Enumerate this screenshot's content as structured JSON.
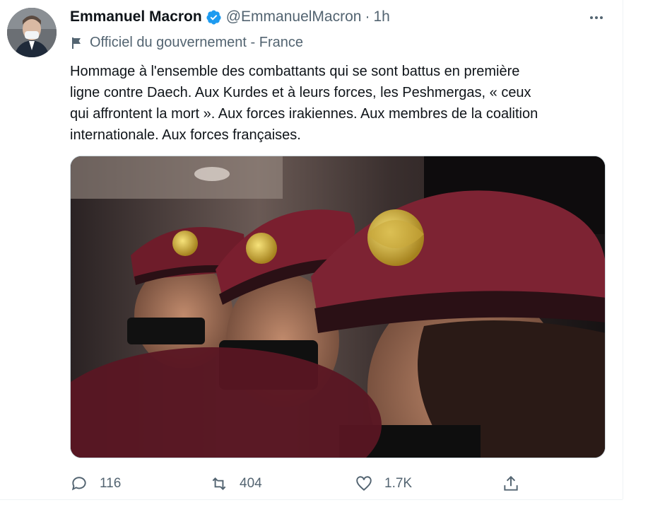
{
  "tweet": {
    "author_name": "Emmanuel Macron",
    "handle": "@EmmanuelMacron",
    "separator": "·",
    "time": "1h",
    "label": "Officiel du gouvernement - France",
    "lines": [
      "Hommage à l'ensemble des combattants qui se sont battus en première",
      "ligne contre Daech. Aux Kurdes et à leurs forces, les Peshmergas, « ceux",
      "qui affrontent la mort ». Aux forces irakiennes. Aux membres de la coalition",
      "internationale. Aux forces françaises."
    ],
    "stats": {
      "replies": "116",
      "retweets": "404",
      "likes": "1.7K"
    },
    "icons": {
      "verified": "verified-badge-icon",
      "more": "more-dots-icon",
      "flag": "flag-icon",
      "reply": "reply-icon",
      "retweet": "retweet-icon",
      "like": "heart-icon",
      "share": "share-icon"
    },
    "colors": {
      "verified_blue": "#1d9bf0",
      "secondary_text": "#536471",
      "beret": "#6e1c2a"
    }
  }
}
